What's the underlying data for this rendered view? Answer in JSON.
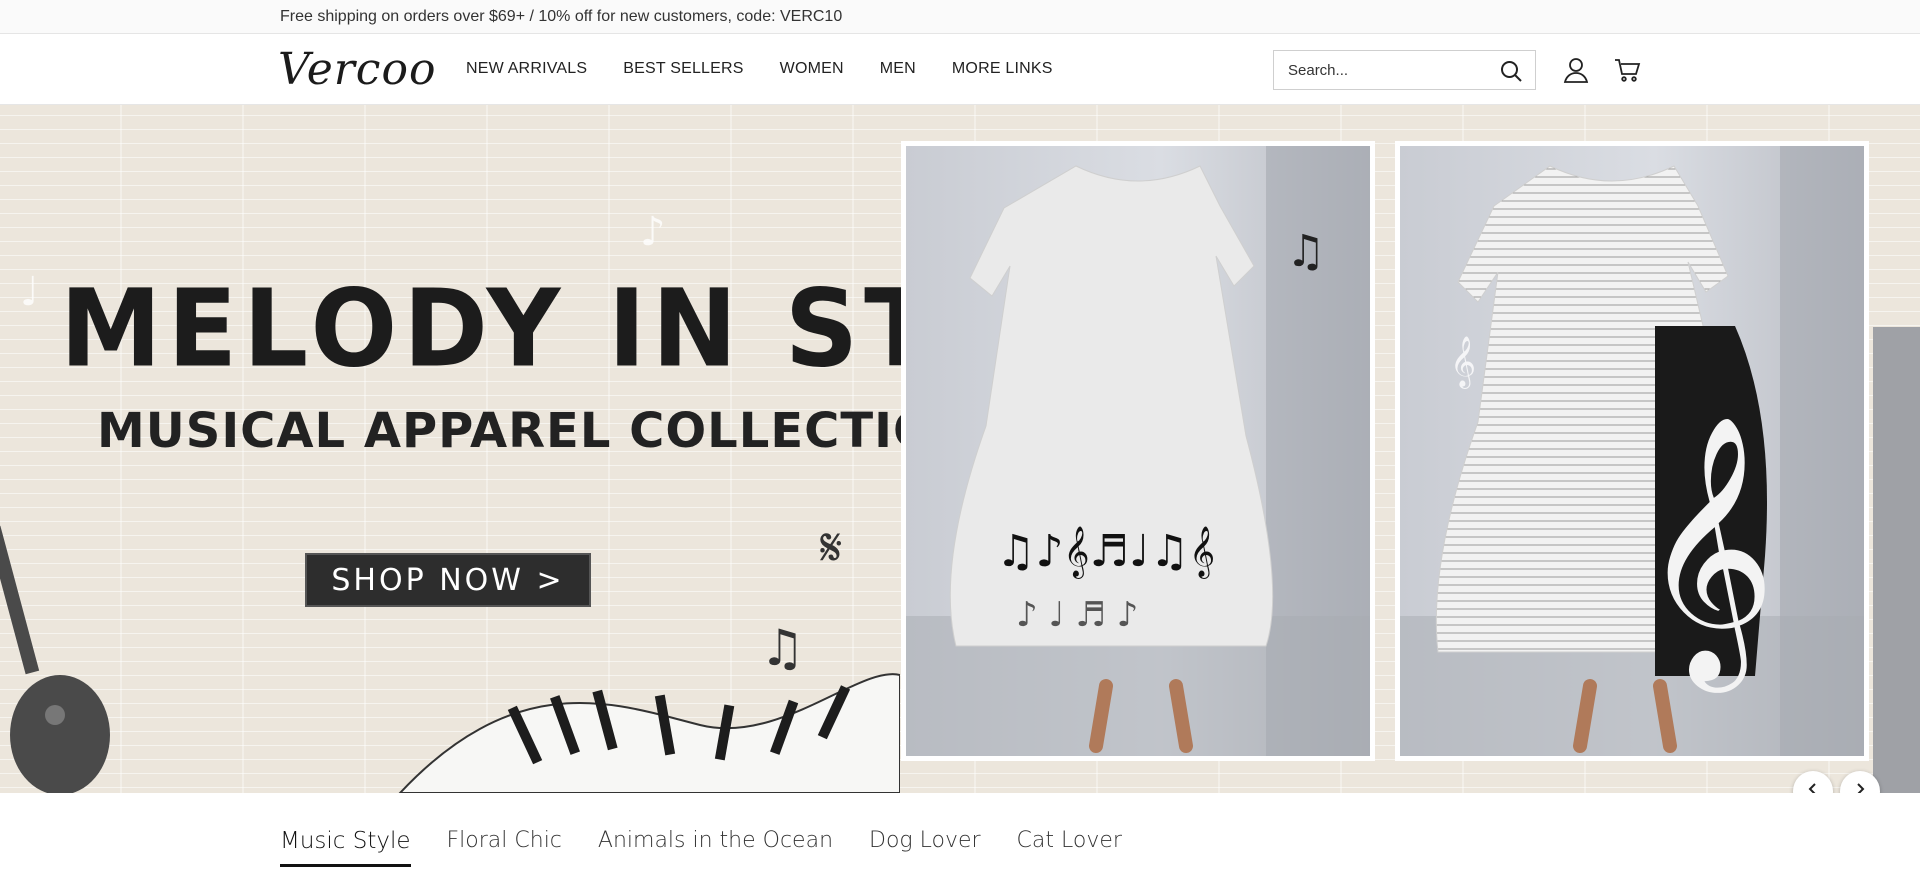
{
  "announcement": {
    "text": "Free shipping on orders over $69+ / 10% off for new customers, code: VERC10"
  },
  "header": {
    "logo": "Vercoo",
    "nav": [
      "NEW ARRIVALS",
      "BEST SELLERS",
      "WOMEN",
      "MEN",
      "MORE LINKS"
    ],
    "search": {
      "placeholder": "Search..."
    },
    "icons": [
      "search-icon",
      "account-icon",
      "cart-icon"
    ]
  },
  "hero": {
    "headline": "MELODY IN STYLE",
    "subheadline": "MUSICAL APPAREL COLLECTION",
    "cta": "SHOP NOW >",
    "photos": [
      "dress-music-notes",
      "dress-treble-clef"
    ]
  },
  "slider": {
    "prev_icon": "chevron-left-icon",
    "next_icon": "chevron-right-icon"
  },
  "tabs": {
    "items": [
      "Music Style",
      "Floral Chic",
      "Animals in the Ocean",
      "Dog Lover",
      "Cat Lover"
    ],
    "active": "Music Style"
  },
  "colors": {
    "text": "#222222",
    "hero_bg": "#ece6dc",
    "button_bg": "#2d2d2d"
  }
}
